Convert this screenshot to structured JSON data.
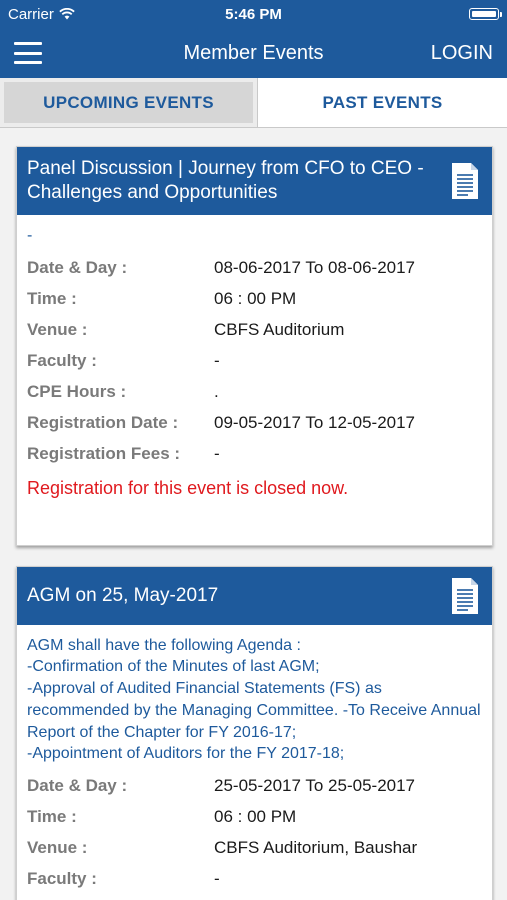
{
  "status_bar": {
    "carrier": "Carrier",
    "time": "5:46 PM"
  },
  "navbar": {
    "title": "Member Events",
    "login_label": "LOGIN"
  },
  "tabs": [
    {
      "label": "UPCOMING EVENTS",
      "active": true
    },
    {
      "label": "PAST EVENTS",
      "active": false
    }
  ],
  "events": [
    {
      "title": "Panel Discussion |  Journey from CFO to CEO - Challenges and Opportunities",
      "description": "-",
      "fields": [
        {
          "label": "Date & Day :",
          "value": "08-06-2017 To 08-06-2017"
        },
        {
          "label": "Time :",
          "value": "06 : 00 PM"
        },
        {
          "label": "Venue :",
          "value": "CBFS Auditorium"
        },
        {
          "label": "Faculty :",
          "value": "-"
        },
        {
          "label": "CPE Hours :",
          "value": "."
        },
        {
          "label": "Registration Date :",
          "value": "09-05-2017 To 12-05-2017"
        },
        {
          "label": "Registration Fees :",
          "value": "-"
        }
      ],
      "closed_message": "Registration for this event is closed now."
    },
    {
      "title": "AGM on 25, May-2017",
      "description": "AGM shall have the following Agenda :\n-Confirmation of the Minutes of last AGM;\n-Approval of Audited Financial Statements (FS) as recommended by the Managing Committee. -To Receive Annual Report of the Chapter for FY 2016-17;\n-Appointment of Auditors for the FY 2017-18;",
      "fields": [
        {
          "label": "Date & Day :",
          "value": "25-05-2017 To 25-05-2017"
        },
        {
          "label": "Time :",
          "value": "06 : 00 PM"
        },
        {
          "label": "Venue :",
          "value": "CBFS Auditorium, Baushar"
        },
        {
          "label": "Faculty :",
          "value": "-"
        }
      ]
    }
  ],
  "colors": {
    "primary": "#1e5a9c",
    "label_gray": "#7a7a7a",
    "closed_red": "#e0191e"
  },
  "icons": {
    "menu": "hamburger-menu-icon",
    "document": "document-icon",
    "wifi": "wifi-icon",
    "battery": "battery-icon"
  }
}
